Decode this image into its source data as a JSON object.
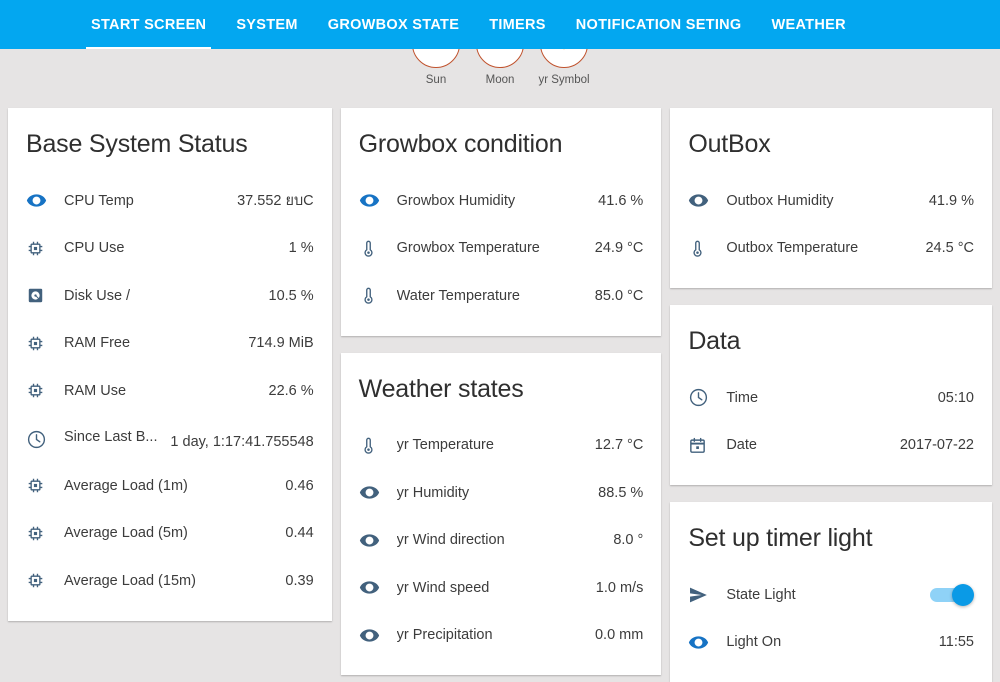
{
  "nav": {
    "items": [
      {
        "label": "START SCREEN",
        "active": true
      },
      {
        "label": "SYSTEM",
        "active": false
      },
      {
        "label": "GROWBOX STATE",
        "active": false
      },
      {
        "label": "TIMERS",
        "active": false
      },
      {
        "label": "NOTIFICATION SETING",
        "active": false
      },
      {
        "label": "WEATHER",
        "active": false
      }
    ],
    "accent_color": "#03a7f0"
  },
  "symbols": [
    {
      "label": "Sun",
      "icon": "sun-face-icon"
    },
    {
      "label": "Moon",
      "icon": "moon-icon"
    },
    {
      "label": "yr Symbol",
      "icon": "sunburst-icon"
    }
  ],
  "cards": {
    "base_system_status": {
      "title": "Base System Status",
      "rows": [
        {
          "icon": "eye-icon",
          "icon_style": "eye-blue",
          "label": "CPU Temp",
          "value": "37.552 ยบC"
        },
        {
          "icon": "cpu-chip-icon",
          "icon_style": "eye-slate",
          "label": "CPU Use",
          "value": "1 %"
        },
        {
          "icon": "hard-disk-icon",
          "icon_style": "eye-slate",
          "label": "Disk Use /",
          "value": "10.5 %"
        },
        {
          "icon": "cpu-chip-icon",
          "icon_style": "eye-slate",
          "label": "RAM Free",
          "value": "714.9 MiB"
        },
        {
          "icon": "cpu-chip-icon",
          "icon_style": "eye-slate",
          "label": "RAM Use",
          "value": "22.6 %"
        },
        {
          "icon": "clock-icon",
          "icon_style": "eye-slate",
          "label": "Since Last B...",
          "value": "1 day, 1:17:41.755548",
          "wrapped": true
        },
        {
          "icon": "cpu-chip-icon",
          "icon_style": "eye-slate",
          "label": "Average Load (1m)",
          "value": "0.46"
        },
        {
          "icon": "cpu-chip-icon",
          "icon_style": "eye-slate",
          "label": "Average Load (5m)",
          "value": "0.44"
        },
        {
          "icon": "cpu-chip-icon",
          "icon_style": "eye-slate",
          "label": "Average Load (15m)",
          "value": "0.39"
        }
      ]
    },
    "growbox_condition": {
      "title": "Growbox condition",
      "rows": [
        {
          "icon": "eye-icon",
          "icon_style": "eye-blue",
          "label": "Growbox Humidity",
          "value": "41.6 %"
        },
        {
          "icon": "thermometer-icon",
          "icon_style": "eye-slate",
          "label": "Growbox Temperature",
          "value": "24.9 °C"
        },
        {
          "icon": "thermometer-icon",
          "icon_style": "eye-slate",
          "label": "Water Temperature",
          "value": "85.0 °C"
        }
      ]
    },
    "weather_states": {
      "title": "Weather states",
      "rows": [
        {
          "icon": "thermometer-icon",
          "icon_style": "eye-slate",
          "label": "yr Temperature",
          "value": "12.7 °C"
        },
        {
          "icon": "eye-icon",
          "icon_style": "eye-slate",
          "label": "yr Humidity",
          "value": "88.5 %"
        },
        {
          "icon": "eye-icon",
          "icon_style": "eye-slate",
          "label": "yr Wind direction",
          "value": "8.0 °"
        },
        {
          "icon": "eye-icon",
          "icon_style": "eye-slate",
          "label": "yr Wind speed",
          "value": "1.0 m/s"
        },
        {
          "icon": "eye-icon",
          "icon_style": "eye-slate",
          "label": "yr Precipitation",
          "value": "0.0 mm"
        }
      ]
    },
    "outbox": {
      "title": "OutBox",
      "rows": [
        {
          "icon": "eye-icon",
          "icon_style": "eye-slate",
          "label": "Outbox Humidity",
          "value": "41.9 %"
        },
        {
          "icon": "thermometer-icon",
          "icon_style": "eye-slate",
          "label": "Outbox Temperature",
          "value": "24.5 °C"
        }
      ]
    },
    "data": {
      "title": "Data",
      "rows": [
        {
          "icon": "clock-icon",
          "icon_style": "eye-slate",
          "label": "Time",
          "value": "05:10"
        },
        {
          "icon": "calendar-icon",
          "icon_style": "eye-slate",
          "label": "Date",
          "value": "2017-07-22"
        }
      ]
    },
    "timer_light": {
      "title": "Set up timer light",
      "rows": [
        {
          "icon": "send-icon",
          "icon_style": "eye-slate",
          "label": "State Light",
          "value": "",
          "toggle": true,
          "toggle_on": true
        },
        {
          "icon": "eye-icon",
          "icon_style": "eye-blue",
          "label": "Light On",
          "value": "11:55"
        }
      ]
    }
  }
}
